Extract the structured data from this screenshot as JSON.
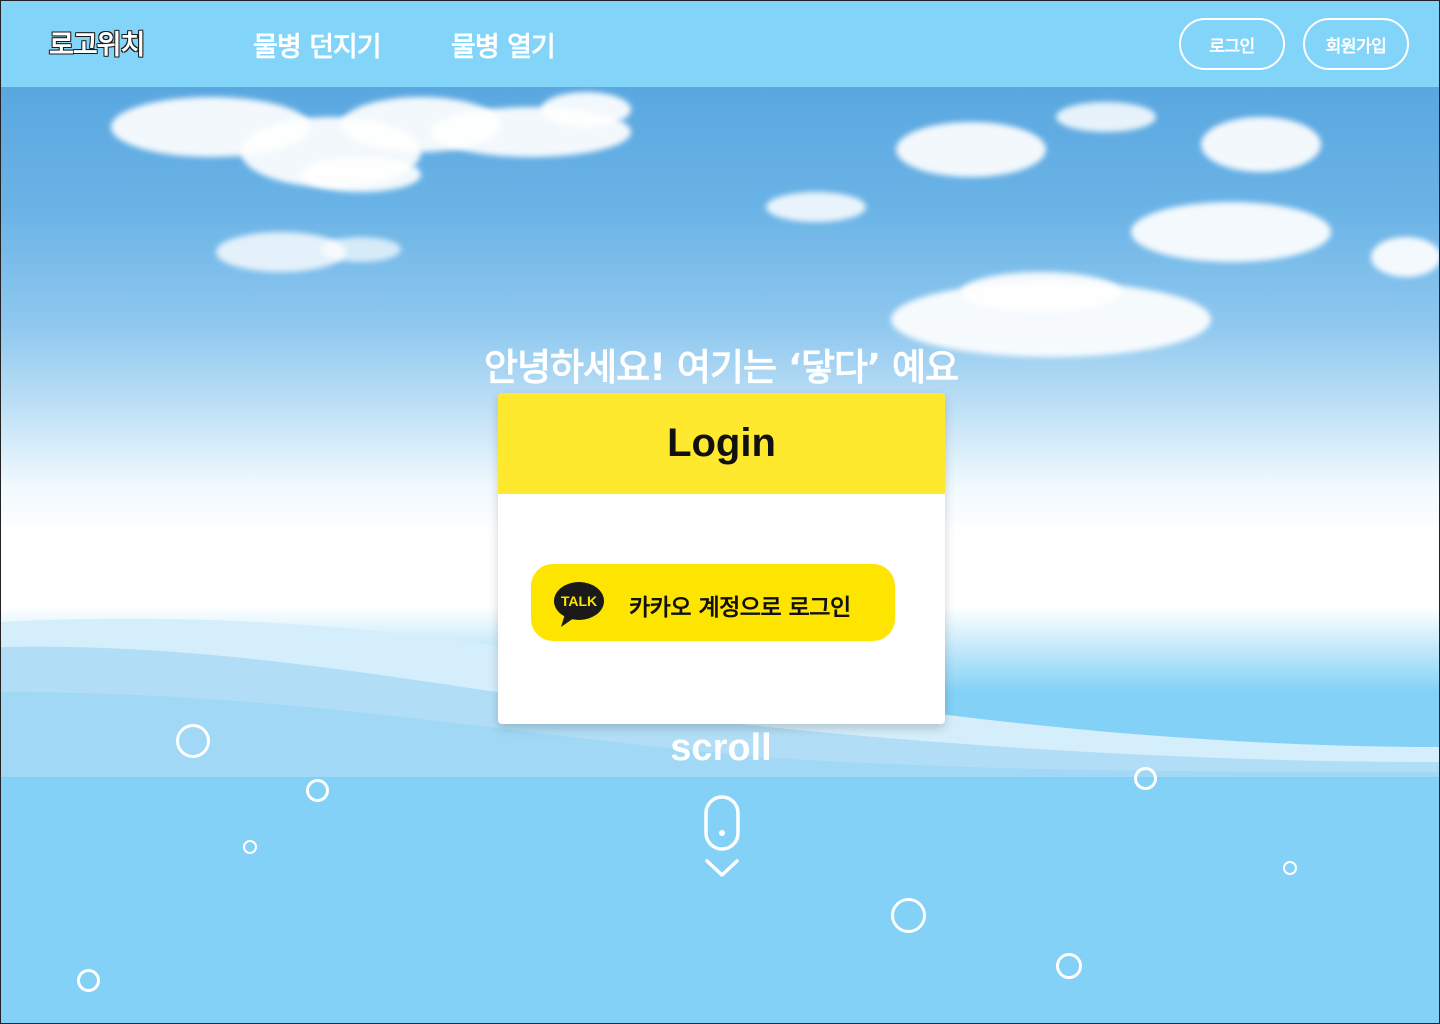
{
  "header": {
    "logo": "로고위치",
    "nav": [
      {
        "label": "물병 던지기"
      },
      {
        "label": "물병 열기"
      }
    ],
    "login_label": "로그인",
    "signup_label": "회원가입"
  },
  "hero": {
    "greeting": "안녕하세요! 여기는 ‘닿다’ 예요",
    "scroll_label": "scroll"
  },
  "login_card": {
    "title": "Login",
    "kakao_icon_text": "TALK",
    "kakao_button_label": "카카오 계정으로 로그인"
  },
  "colors": {
    "header_bg": "#83d4f9",
    "card_header": "#ffe92e",
    "kakao_yellow": "#fee500",
    "water": "#83d1f6"
  },
  "icons": {
    "kakao": "kakao-talk-bubble-icon",
    "scroll": "mouse-scroll-icon",
    "bubbles": "bubble-icon"
  }
}
